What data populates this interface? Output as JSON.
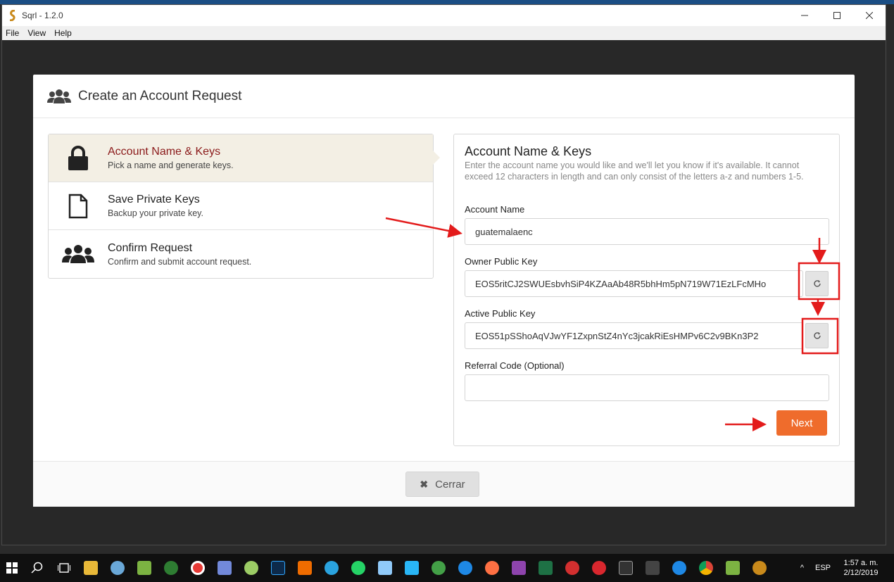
{
  "window": {
    "title": "Sqrl - 1.2.0",
    "menu": [
      "File",
      "View",
      "Help"
    ]
  },
  "modal": {
    "title": "Create an Account Request",
    "close_label": "Cerrar"
  },
  "steps": [
    {
      "title": "Account Name & Keys",
      "desc": "Pick a name and generate keys.",
      "icon": "lock-icon",
      "active": true
    },
    {
      "title": "Save Private Keys",
      "desc": "Backup your private key.",
      "icon": "file-icon",
      "active": false
    },
    {
      "title": "Confirm Request",
      "desc": "Confirm and submit account request.",
      "icon": "users-icon",
      "active": false
    }
  ],
  "form": {
    "title": "Account Name & Keys",
    "description": "Enter the account name you would like and we'll let you know if it's available. It cannot exceed 12 characters in length and can only consist of the letters a-z and numbers 1-5.",
    "account_name_label": "Account Name",
    "account_name_value": "guatemalaenc",
    "owner_key_label": "Owner Public Key",
    "owner_key_value": "EOS5ritCJ2SWUEsbvhSiP4KZAaAb48R5bhHm5pN719W71EzLFcMHo",
    "active_key_label": "Active Public Key",
    "active_key_value": "EOS51pSShoAqVJwYF1ZxpnStZ4nYc3jcakRiEsHMPv6C2v9BKn3P2",
    "referral_label": "Referral Code (Optional)",
    "referral_value": "",
    "next_label": "Next"
  },
  "taskbar": {
    "language": "ESP",
    "time": "1:57 a. m.",
    "date": "2/12/2019"
  },
  "colors": {
    "accent": "#ef6c2c",
    "active_step_bg": "#f3efe4",
    "active_step_text": "#8b1a1a",
    "annotation_red": "#e31b1b"
  }
}
